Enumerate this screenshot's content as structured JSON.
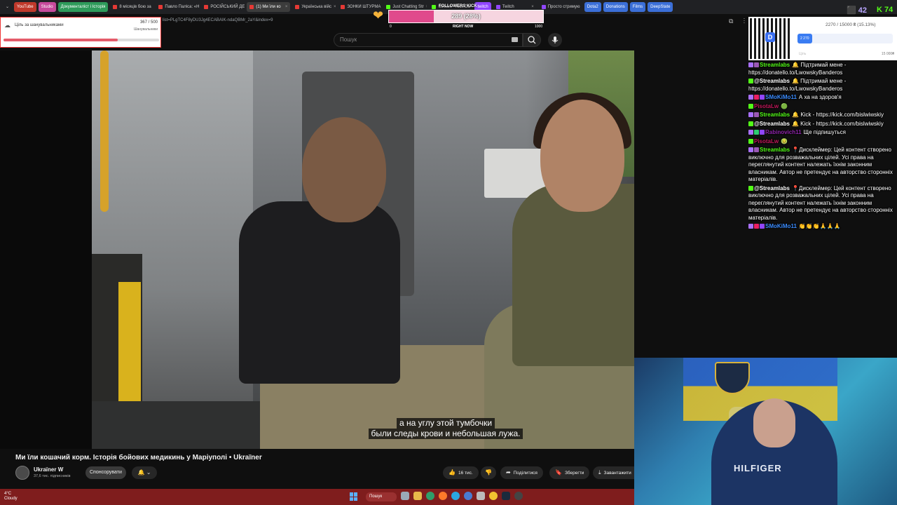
{
  "browser": {
    "tabs": [
      {
        "label": "YouTube",
        "kind": "pill",
        "color": "#c0392b"
      },
      {
        "label": "Studio",
        "kind": "pill",
        "color": "#c74a9c"
      },
      {
        "label": "Документаліст і Історія",
        "kind": "pill",
        "color": "#2e9a5a"
      },
      {
        "label": "8 місяців бою за",
        "kind": "page",
        "color": "#e53935"
      },
      {
        "label": "Павло Паліса: «Н",
        "kind": "page",
        "color": "#e53935"
      },
      {
        "label": "РОСІЙСЬКИЙ ДЕ",
        "kind": "page",
        "color": "#e53935"
      },
      {
        "label": "(1) Ми їли ко",
        "kind": "active",
        "color": "#e53935"
      },
      {
        "label": "Українська війс",
        "kind": "page",
        "color": "#e53935"
      },
      {
        "label": "ЗОНКИ ШТУРМА",
        "kind": "page",
        "color": "#e53935"
      },
      {
        "label": "Just Chatting Str",
        "kind": "page",
        "color": "#53fc18"
      },
      {
        "label": "Stream - Kick Da",
        "kind": "page",
        "color": "#53fc18"
      },
      {
        "label": "twitch",
        "kind": "pill",
        "color": "#9146ff"
      },
      {
        "label": "Twitch",
        "kind": "page",
        "color": "#9146ff"
      },
      {
        "label": "Просто стримую",
        "kind": "page",
        "color": "#9146ff"
      },
      {
        "label": "Dota2",
        "kind": "pill",
        "color": "#3b6fd8"
      },
      {
        "label": "Donations",
        "kind": "pill",
        "color": "#3b6fd8"
      },
      {
        "label": "Films",
        "kind": "pill",
        "color": "#3b6fd8"
      },
      {
        "label": "DeepState",
        "kind": "pill",
        "color": "#3b6fd8"
      }
    ],
    "url": "list=PLgTC4F8yDU3Jg4ECABAIK-ndaQBMr_2aY&index=9"
  },
  "youtube": {
    "search_placeholder": "Пошук",
    "subtitle_line1": "а на углу этой тумбочки",
    "subtitle_line2": "были следы крови и небольшая лужа.",
    "video_title": "Ми їли кошачий корм. Історія бойових медикинь у Маріуполі • Ukraїner",
    "channel_name": "Ukraїner W",
    "channel_subs": "37,6 тис. підписників",
    "sponsor_label": "Спонсорувати",
    "bell_label": "🔔 ⌄",
    "likes": "16 тис.",
    "share_label": "Поділитися",
    "save_label": "Зберегти",
    "download_label": "Завантажити"
  },
  "goal_widget": {
    "title": "Ціль за шанувальниками",
    "count": "367 / 500",
    "subtitle": "Шанувальники",
    "progress": 0.734
  },
  "followers_widget": {
    "label": "FOLLOWERS KICK",
    "value_text": "289 (28%)",
    "progress": 0.289,
    "min": "0",
    "mid": "RIGHT NOW",
    "max": "1000",
    "accent": "#e04a8c"
  },
  "viewers": {
    "twitch": "42",
    "kick": "74"
  },
  "donation_goal": {
    "amount_text": "2270 / 15000 ₴ (15.13%)",
    "bar_label": "2 270",
    "progress": 0.1513,
    "min_label": "Ціль",
    "max_label": "15 000₴"
  },
  "chat": [
    {
      "user": "Streamlabs",
      "color": "#53fc18",
      "badges": [
        "#a970ff",
        "#9b59b6"
      ],
      "text": "🔔 Підтримай мене - https://donatello.to/LwowskyBanderos"
    },
    {
      "user": "@Streamlabs",
      "color": "#ffffff",
      "badges": [
        "#53fc18"
      ],
      "text": "🔔 Підтримай мене - https://donatello.to/LwowskyBanderos"
    },
    {
      "user": "SMoKiMo11",
      "color": "#3b8cff",
      "badges": [
        "#a970ff",
        "#e91e63",
        "#9146ff"
      ],
      "text": "А ха на здоров'я"
    },
    {
      "user": "PisotaLw",
      "color": "#c2185b",
      "badges": [
        "#53fc18"
      ],
      "text": "🟢"
    },
    {
      "user": "Streamlabs",
      "color": "#53fc18",
      "badges": [
        "#a970ff",
        "#9b59b6"
      ],
      "text": "🔔 Kick - https://kick.com/bislwiwskiy"
    },
    {
      "user": "@Streamlabs",
      "color": "#ffffff",
      "badges": [
        "#53fc18"
      ],
      "text": "🔔 Kick - https://kick.com/bislwiwskiy"
    },
    {
      "user": "Rabinovich11",
      "color": "#8e24aa",
      "badges": [
        "#a970ff",
        "#2ecc71",
        "#9146ff"
      ],
      "text": "Ще підпишуться"
    },
    {
      "user": "PisotaLw",
      "color": "#c2185b",
      "badges": [
        "#53fc18"
      ],
      "text": "🤢"
    },
    {
      "user": "Streamlabs",
      "color": "#53fc18",
      "badges": [
        "#a970ff",
        "#9b59b6"
      ],
      "text": "📍Дисклеймер: Цей контент створено виключно для розважальних цілей. Усі права на переглянутий контент належать їхнім законним власникам. Автор не претендує на авторство сторонніх матеріалів."
    },
    {
      "user": "@Streamlabs",
      "color": "#ffffff",
      "badges": [
        "#53fc18"
      ],
      "text": "📍Дисклеймер: Цей контент створено виключно для розважальних цілей. Усі права на переглянутий контент належать їхнім законним власникам. Автор не претендує на авторство сторонніх матеріалів."
    },
    {
      "user": "SMoKiMo11",
      "color": "#3b8cff",
      "badges": [
        "#a970ff",
        "#e91e63",
        "#9146ff"
      ],
      "text": "👏👏👏🙏🙏🙏"
    }
  ],
  "taskbar": {
    "weather_temp": "4°C",
    "weather_desc": "Cloudy",
    "search_label": "Пошук"
  },
  "webcam": {
    "shirt_text": "HILFIGER"
  }
}
